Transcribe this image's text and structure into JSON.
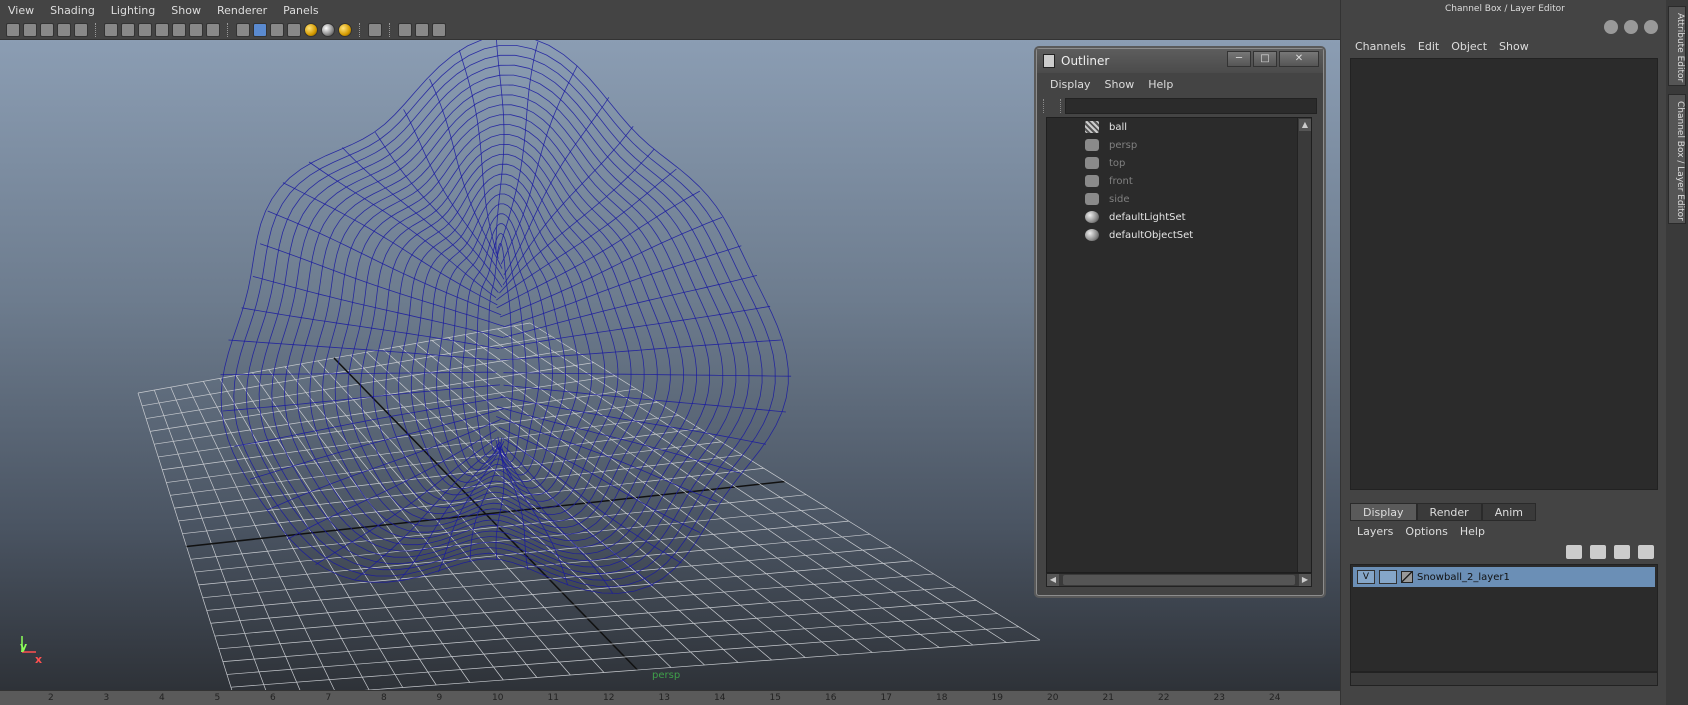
{
  "menubar": {
    "items": [
      "View",
      "Shading",
      "Lighting",
      "Show",
      "Renderer",
      "Panels"
    ]
  },
  "viewport": {
    "camera_label": "persp",
    "axis": {
      "y": "y",
      "x": "x"
    }
  },
  "outliner": {
    "title": "Outliner",
    "menu": [
      "Display",
      "Show",
      "Help"
    ],
    "search_value": "",
    "items": [
      {
        "label": "ball",
        "icon": "mesh-icon",
        "dim": false
      },
      {
        "label": "persp",
        "icon": "camera-icon",
        "dim": true
      },
      {
        "label": "top",
        "icon": "camera-icon",
        "dim": true
      },
      {
        "label": "front",
        "icon": "camera-icon",
        "dim": true
      },
      {
        "label": "side",
        "icon": "camera-icon",
        "dim": true
      },
      {
        "label": "defaultLightSet",
        "icon": "set-icon",
        "dim": false
      },
      {
        "label": "defaultObjectSet",
        "icon": "set-icon",
        "dim": false
      }
    ],
    "window_buttons": {
      "minimize": "─",
      "maximize": "□",
      "close": "✕"
    }
  },
  "channel_box": {
    "title": "Channel Box / Layer Editor",
    "menu": [
      "Channels",
      "Edit",
      "Object",
      "Show"
    ]
  },
  "layer_editor": {
    "tabs": [
      "Display",
      "Render",
      "Anim"
    ],
    "active_tab": "Display",
    "menu": [
      "Layers",
      "Options",
      "Help"
    ],
    "layers": [
      {
        "visible": "V",
        "name": "Snowball_2_layer1"
      }
    ]
  },
  "side_tabs": [
    "Attribute Editor",
    "Channel Box / Layer Editor"
  ],
  "timeline": {
    "ticks": [
      "2",
      "3",
      "4",
      "5",
      "6",
      "7",
      "8",
      "9",
      "10",
      "11",
      "12",
      "13",
      "14",
      "15",
      "16",
      "17",
      "18",
      "19",
      "20",
      "21",
      "22",
      "23",
      "24"
    ]
  },
  "colors": {
    "wire": "#1a1aa0",
    "layer_highlight": "#6b8fb6"
  }
}
